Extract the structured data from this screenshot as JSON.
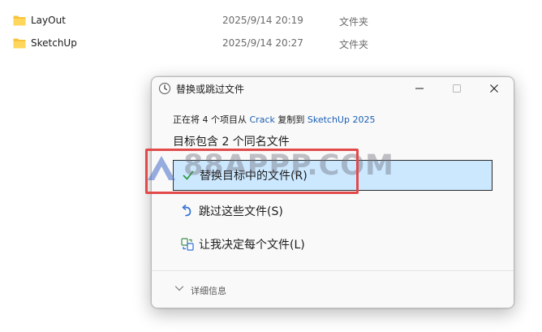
{
  "explorer": {
    "rows": [
      {
        "name": "LayOut",
        "date": "2025/9/14 20:19",
        "type": "文件夹"
      },
      {
        "name": "SketchUp",
        "date": "2025/9/14 20:27",
        "type": "文件夹"
      }
    ]
  },
  "dialog": {
    "title": "替换或跳过文件",
    "subline": {
      "prefix": "正在将 4 个项目从 ",
      "source": "Crack",
      "middle": " 复制到 ",
      "destination": "SketchUp 2025"
    },
    "heading": "目标包含 2 个同名文件",
    "options": [
      {
        "label": "替换目标中的文件(R)",
        "icon": "checkmark-icon",
        "selected": true
      },
      {
        "label": "跳过这些文件(S)",
        "icon": "skip-arrow-icon",
        "selected": false
      },
      {
        "label": "让我决定每个文件(L)",
        "icon": "decide-files-icon",
        "selected": false
      }
    ],
    "details_label": "详细信息"
  },
  "watermark": {
    "text": "88APPP.COM"
  },
  "colors": {
    "selected_bg": "#cce8ff",
    "link": "#1a5fb4",
    "highlight": "#e24a4a",
    "folder": "#f8c33c"
  }
}
